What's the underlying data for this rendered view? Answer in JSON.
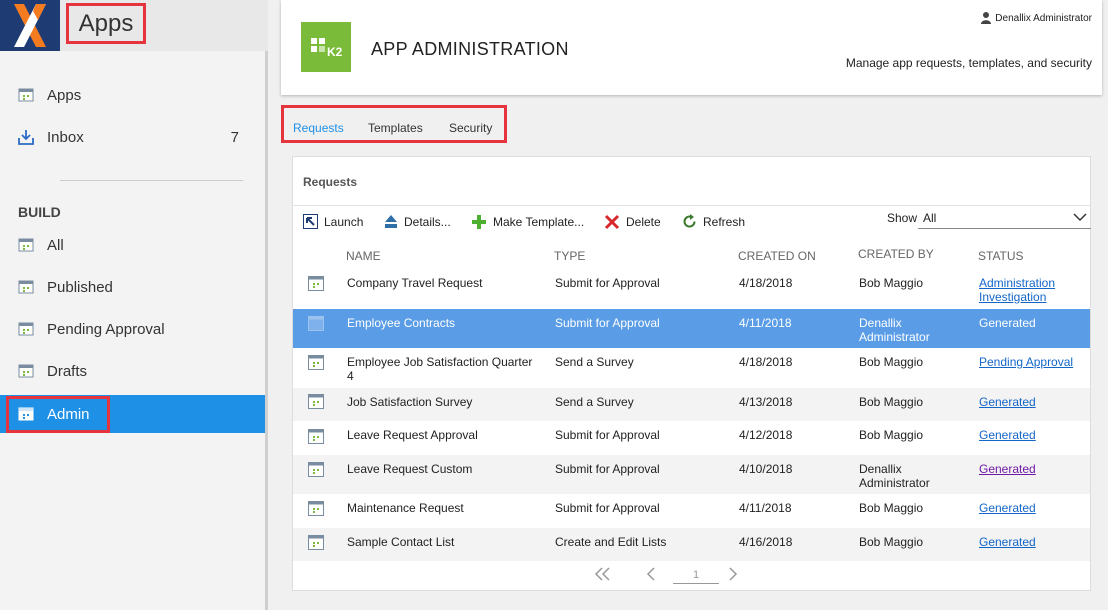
{
  "sidebar": {
    "app_title": "Apps",
    "items": [
      {
        "label": "Apps",
        "count": ""
      },
      {
        "label": "Inbox",
        "count": "7"
      }
    ],
    "build_heading": "BUILD",
    "build_items": [
      {
        "label": "All"
      },
      {
        "label": "Published"
      },
      {
        "label": "Pending Approval"
      },
      {
        "label": "Drafts"
      },
      {
        "label": "Admin"
      }
    ]
  },
  "header": {
    "logo_text": "K2",
    "title": "APP ADMINISTRATION",
    "user": "Denallix Administrator",
    "subtitle": "Manage app requests, templates, and security"
  },
  "tabs": [
    {
      "label": "Requests"
    },
    {
      "label": "Templates"
    },
    {
      "label": "Security"
    }
  ],
  "card": {
    "title": "Requests",
    "toolbar": {
      "launch": "Launch",
      "details": "Details...",
      "make_template": "Make Template...",
      "delete": "Delete",
      "refresh": "Refresh",
      "show_label": "Show",
      "show_value": "All"
    },
    "columns": {
      "name": "NAME",
      "type": "TYPE",
      "created_on": "CREATED ON",
      "created_by": "CREATED BY",
      "status": "STATUS"
    },
    "rows": [
      {
        "name": "Company Travel Request",
        "type": "Submit for Approval",
        "created_on": "4/18/2018",
        "created_by": "Bob Maggio",
        "status": "Administration Investigation"
      },
      {
        "name": "Employee Contracts",
        "type": "Submit for Approval",
        "created_on": "4/11/2018",
        "created_by": "Denallix Administrator",
        "status": "Generated"
      },
      {
        "name": "Employee Job Satisfaction Quarter 4",
        "type": "Send a Survey",
        "created_on": "4/18/2018",
        "created_by": "Bob Maggio",
        "status": "Pending Approval"
      },
      {
        "name": "Job Satisfaction Survey",
        "type": "Send a Survey",
        "created_on": "4/13/2018",
        "created_by": "Bob Maggio",
        "status": "Generated"
      },
      {
        "name": "Leave Request Approval",
        "type": "Submit for Approval",
        "created_on": "4/12/2018",
        "created_by": "Bob Maggio",
        "status": "Generated"
      },
      {
        "name": "Leave Request Custom",
        "type": "Submit for Approval",
        "created_on": "4/10/2018",
        "created_by": "Denallix Administrator",
        "status": "Generated"
      },
      {
        "name": "Maintenance Request",
        "type": "Submit for Approval",
        "created_on": "4/11/2018",
        "created_by": "Bob Maggio",
        "status": "Generated"
      },
      {
        "name": "Sample Contact List",
        "type": "Create and Edit Lists",
        "created_on": "4/16/2018",
        "created_by": "Bob Maggio",
        "status": "Generated"
      }
    ],
    "pager": {
      "page": "1"
    }
  },
  "colors": {
    "accent": "#1e90e6",
    "selected_row": "#5a9de6",
    "highlight": "#e5343e",
    "k2_green": "#7bbb3a",
    "logo_bg": "#1f3b73",
    "link": "#1466c8",
    "visited_link": "#6f1aa5"
  }
}
